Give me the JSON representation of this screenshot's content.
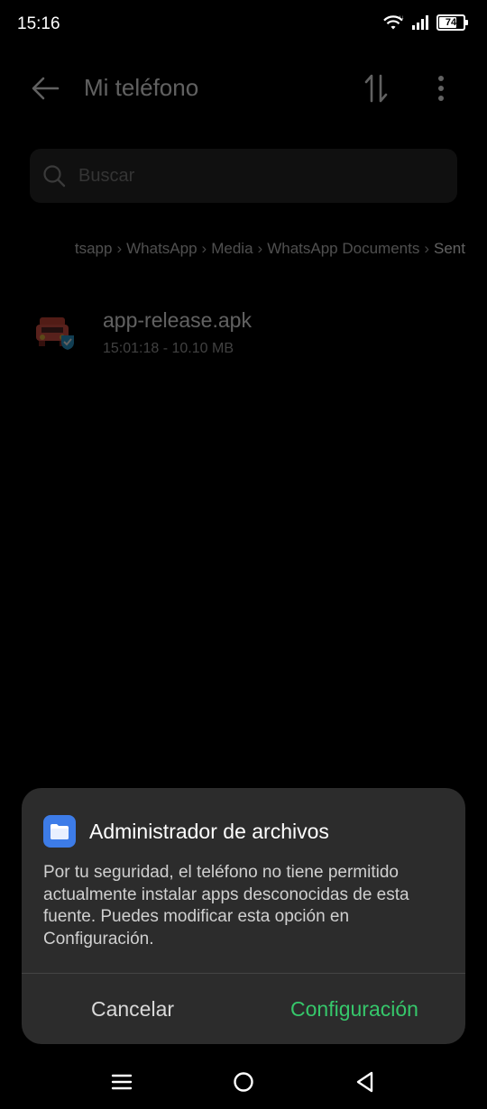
{
  "status_bar": {
    "time": "15:16",
    "battery_level": "74",
    "battery_fraction": 0.74
  },
  "toolbar": {
    "title": "Mi teléfono",
    "back_icon": "arrow-left-icon",
    "sort_icon": "sort-icon",
    "more_icon": "more-vert-icon"
  },
  "search": {
    "placeholder": "Buscar"
  },
  "breadcrumb": {
    "items": [
      "tsapp",
      "WhatsApp",
      "Media",
      "WhatsApp Documents",
      "Sent"
    ]
  },
  "files": [
    {
      "name": "app-release.apk",
      "meta": "15:01:18 - 10.10 MB",
      "icon": "apk-file-icon"
    }
  ],
  "dialog": {
    "title": "Administrador de archivos",
    "message": "Por tu seguridad, el teléfono no tiene permitido actualmente instalar apps desconocidas de esta fuente. Puedes modificar esta opción en Configuración.",
    "cancel_label": "Cancelar",
    "confirm_label": "Configuración",
    "confirm_color": "#36c76b",
    "app_icon": "folder-icon",
    "app_icon_color": "#3d7ce8"
  },
  "nav_bar": {
    "recents_icon": "menu-icon",
    "home_icon": "home-circle-icon",
    "back_icon": "back-triangle-icon"
  }
}
